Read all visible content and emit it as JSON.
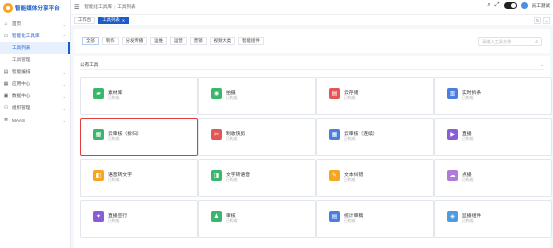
{
  "brand": {
    "title": "智能媒体分享平台"
  },
  "sidebar": {
    "items": [
      {
        "name": "sidebar-item-home",
        "label": "首页",
        "icon": "home-icon",
        "glyph": "⌂",
        "type": "group"
      },
      {
        "name": "sidebar-item-smart-tools",
        "label": "智能化工具库",
        "icon": "monitor-icon",
        "glyph": "▭",
        "type": "open"
      },
      {
        "name": "sidebar-item-tool-list",
        "label": "工具列表",
        "type": "sub-active"
      },
      {
        "name": "sidebar-item-tool-manage",
        "label": "工具管理",
        "type": "sub"
      },
      {
        "name": "sidebar-item-smart-edit",
        "label": "智能编排",
        "icon": "clipboard-icon",
        "glyph": "▤",
        "type": "group"
      },
      {
        "name": "sidebar-item-app-center",
        "label": "应用中心",
        "icon": "grid-icon",
        "glyph": "▦",
        "type": "group"
      },
      {
        "name": "sidebar-item-data-center",
        "label": "数据中心",
        "icon": "database-icon",
        "glyph": "▣",
        "type": "group"
      },
      {
        "name": "sidebar-item-system",
        "label": "组织管理",
        "icon": "people-icon",
        "glyph": "⚇",
        "type": "group"
      },
      {
        "name": "sidebar-item-maas",
        "label": "MAAS",
        "icon": "layers-icon",
        "glyph": "≣",
        "type": "group"
      }
    ]
  },
  "topbar": {
    "crumbs": [
      "智能化工具库",
      "工具列表"
    ],
    "username": "员工测试"
  },
  "tabs": [
    {
      "label": "工作台",
      "active": false
    },
    {
      "label": "工具列表",
      "active": true
    }
  ],
  "filters": {
    "chips": [
      "全部",
      "制作",
      "分发传播",
      "运维",
      "运营",
      "营销",
      "视频大类",
      "智能组件"
    ],
    "search_placeholder": "请输入工具名称"
  },
  "section": {
    "title": "公有工具"
  },
  "cards": [
    {
      "title": "素材库",
      "status": "已构成",
      "color": "#39b76b",
      "icon": "folder-icon",
      "glyph": "▰",
      "selected": false
    },
    {
      "title": "拍摄",
      "status": "已构成",
      "color": "#39b76b",
      "icon": "camera-icon",
      "glyph": "◉",
      "selected": false
    },
    {
      "title": "云存储",
      "status": "已构成",
      "color": "#e25656",
      "icon": "cloud-storage-icon",
      "glyph": "▤",
      "selected": false
    },
    {
      "title": "实时拆条",
      "status": "已构成",
      "color": "#4a7fe0",
      "icon": "split-icon",
      "glyph": "▥",
      "selected": false
    },
    {
      "title": "云审核（拆归）",
      "status": "已构成",
      "color": "#39b76b",
      "icon": "review-icon",
      "glyph": "▦",
      "selected": true
    },
    {
      "title": "制收快剪",
      "status": "已构成",
      "color": "#e25656",
      "icon": "scissors-icon",
      "glyph": "✂",
      "selected": false
    },
    {
      "title": "云审核（连续）",
      "status": "已构成",
      "color": "#4a7fe0",
      "icon": "review-icon",
      "glyph": "▦",
      "selected": false
    },
    {
      "title": "直播",
      "status": "已构成",
      "color": "#8a5cd6",
      "icon": "live-icon",
      "glyph": "▶",
      "selected": false
    },
    {
      "title": "语音转文字",
      "status": "已构成",
      "color": "#f5a623",
      "icon": "speech-icon",
      "glyph": "◧",
      "selected": false
    },
    {
      "title": "文字转语音",
      "status": "已构成",
      "color": "#39b76b",
      "icon": "tts-icon",
      "glyph": "◨",
      "selected": false
    },
    {
      "title": "文本纠错",
      "status": "已构成",
      "color": "#f5a623",
      "icon": "edit-icon",
      "glyph": "✎",
      "selected": false
    },
    {
      "title": "点播",
      "status": "已构成",
      "color": "#b07ad8",
      "icon": "cloud-icon",
      "glyph": "☁",
      "selected": false
    },
    {
      "title": "直播宣行",
      "status": "已构成",
      "color": "#8a5cd6",
      "icon": "broadcast-icon",
      "glyph": "✦",
      "selected": false
    },
    {
      "title": "审核",
      "status": "已构成",
      "color": "#39b76b",
      "icon": "user-check-icon",
      "glyph": "♟",
      "selected": false
    },
    {
      "title": "统计审稿",
      "status": "已构成",
      "color": "#4a7fe0",
      "icon": "stats-icon",
      "glyph": "▤",
      "selected": false
    },
    {
      "title": "监播组件",
      "status": "已构成",
      "color": "#4a9de0",
      "icon": "monitor-icon",
      "glyph": "◈",
      "selected": false
    }
  ]
}
